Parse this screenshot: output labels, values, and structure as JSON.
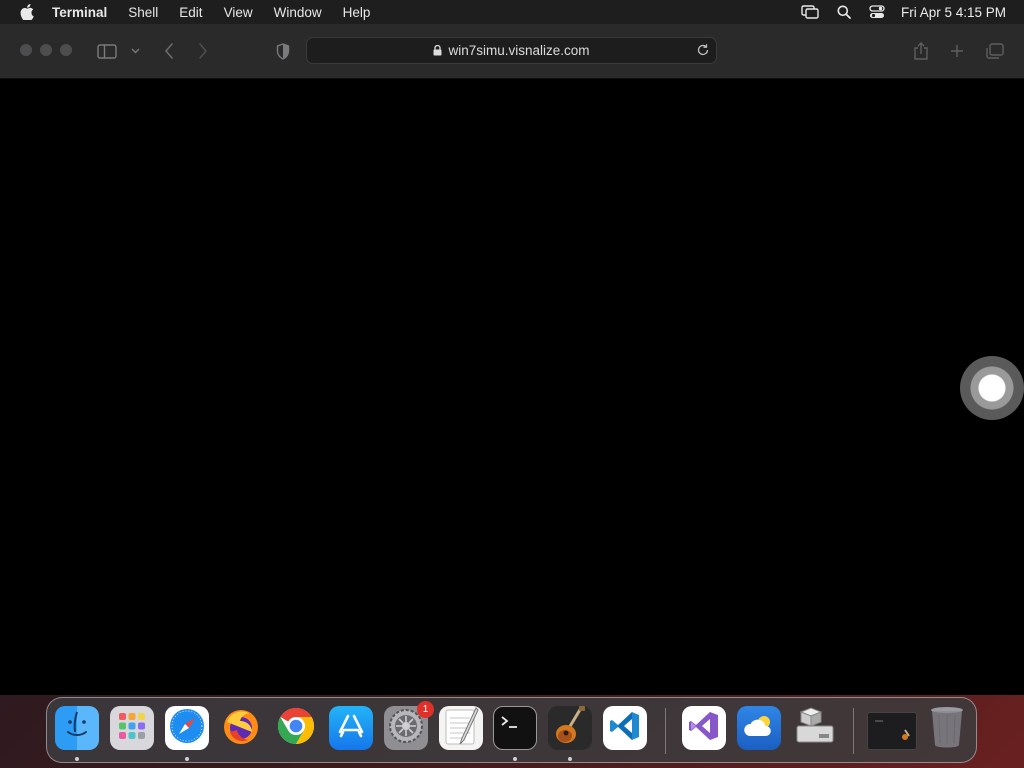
{
  "menubar": {
    "app_name": "Terminal",
    "items": [
      "Shell",
      "Edit",
      "View",
      "Window",
      "Help"
    ],
    "clock": "Fri Apr 5  4:15 PM"
  },
  "browser": {
    "url": "win7simu.visnalize.com"
  },
  "dock": {
    "apps": [
      {
        "name": "Finder",
        "running": true
      },
      {
        "name": "Launchpad",
        "running": false
      },
      {
        "name": "Safari",
        "running": true
      },
      {
        "name": "Firefox",
        "running": false
      },
      {
        "name": "Chrome",
        "running": false
      },
      {
        "name": "App Store",
        "running": false
      },
      {
        "name": "System Settings",
        "running": false,
        "badge": "1"
      },
      {
        "name": "TextEdit",
        "running": false
      },
      {
        "name": "Terminal",
        "running": true
      },
      {
        "name": "GarageBand",
        "running": true
      },
      {
        "name": "Visual Studio Code",
        "running": false
      },
      {
        "name": "Visual Studio",
        "running": false
      },
      {
        "name": "Weather",
        "running": false
      },
      {
        "name": "Boot Camp Assistant",
        "running": false
      },
      {
        "name": "Terminal Window",
        "running": false
      },
      {
        "name": "Trash",
        "running": false
      }
    ],
    "settings_badge": "1"
  }
}
